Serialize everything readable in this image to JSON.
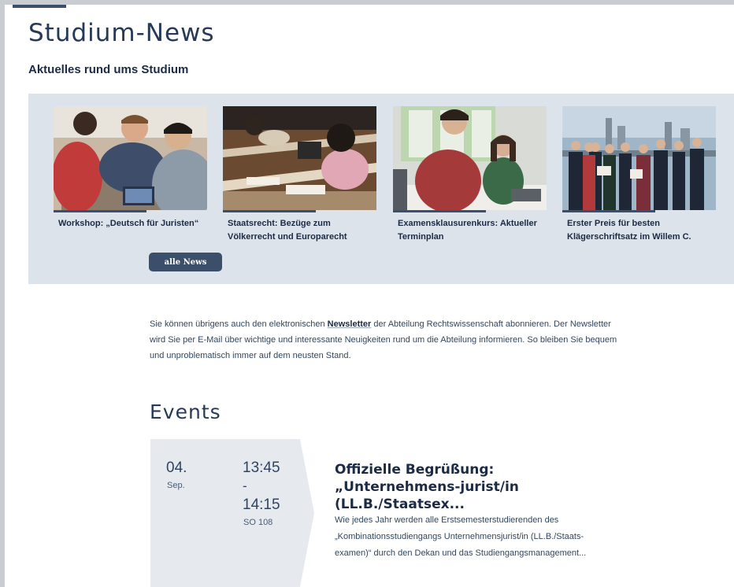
{
  "page": {
    "title": "Studium-News",
    "subtitle": "Aktuelles rund ums Studium"
  },
  "news": {
    "items": [
      {
        "title": "Workshop: „Deutsch für Juristen“",
        "image": "photo-students-workshop"
      },
      {
        "title": "Staatsrecht: Bezüge zum Völkerrecht und Europarecht",
        "image": "photo-lecture-hall"
      },
      {
        "title": "Examensklausurenkurs: Aktueller Terminplan",
        "image": "photo-students-library"
      },
      {
        "title": "Erster Preis für besten Klägerschriftsatz im Willem C.",
        "image": "photo-team-award"
      }
    ],
    "all_button": "alle News"
  },
  "newsletter": {
    "before": "Sie können übrigens auch den elektronischen ",
    "link": "Newsletter",
    "after": " der Abteilung Rechtswissenschaft abonnieren. Der Newsletter wird Sie per E-Mail über wichtige und interessante Neuigkeiten rund um die Abteilung informieren. So bleiben Sie bequem und unproblematisch immer auf dem neusten Stand."
  },
  "events": {
    "heading": "Events",
    "items": [
      {
        "day": "04.",
        "month": "Sep.",
        "time_start": "13:45",
        "dash": "-",
        "time_end": "14:15",
        "room": "SO 108",
        "title": "Offizielle Begrüßung: „Unternehmens-jurist/in (LL.B./Staatsex...",
        "description": "Wie jedes Jahr werden alle Erstsemesterstudierenden des „Kombinationsstudiengangs Unternehmensjurist/in (LL.B./Staats-examen)“ durch den Dekan und das Studiengangsmanagement..."
      }
    ]
  },
  "colors": {
    "accent": "#3a4f6b",
    "panel": "#dde3ea",
    "text": "#1c2b45"
  }
}
